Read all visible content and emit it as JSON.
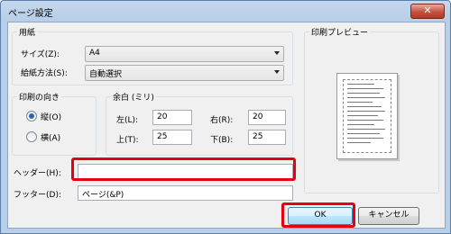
{
  "window": {
    "title": "ページ設定",
    "close_glyph": "✕"
  },
  "paper": {
    "group_label": "用紙",
    "size_label": "サイズ(Z):",
    "size_value": "A4",
    "source_label": "給紙方法(S):",
    "source_value": "自動選択"
  },
  "orientation": {
    "group_label": "印刷の向き",
    "portrait_label": "縦(O)",
    "landscape_label": "横(A)",
    "selected": "portrait"
  },
  "margins": {
    "group_label": "余白 (ミリ)",
    "left_label": "左(L):",
    "left_value": "20",
    "right_label": "右(R):",
    "right_value": "20",
    "top_label": "上(T):",
    "top_value": "25",
    "bottom_label": "下(B):",
    "bottom_value": "25"
  },
  "preview": {
    "group_label": "印刷プレビュー"
  },
  "header": {
    "label": "ヘッダー(H):",
    "value": ""
  },
  "footer": {
    "label": "フッター(D):",
    "value": "ページ(&P)"
  },
  "buttons": {
    "ok": "OK",
    "cancel": "キャンセル"
  },
  "colors": {
    "highlight": "#e60012",
    "title_gradient": "#b9cfe7",
    "ok_button": "#bee6fd"
  },
  "icons": [
    "close-icon",
    "chevron-down-icon",
    "radio-icon"
  ]
}
